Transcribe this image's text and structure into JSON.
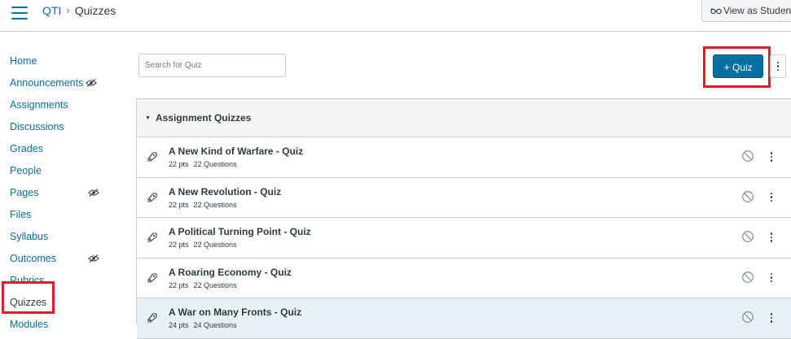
{
  "header": {
    "crumbs": [
      "QTI",
      "Quizzes"
    ],
    "crumb_separator": "›",
    "view_as_student": "View as Student",
    "view_icon": "glasses-icon"
  },
  "sidebar": {
    "items": [
      {
        "label": "Home",
        "hidden": false
      },
      {
        "label": "Announcements",
        "hidden": true
      },
      {
        "label": "Assignments",
        "hidden": false
      },
      {
        "label": "Discussions",
        "hidden": false
      },
      {
        "label": "Grades",
        "hidden": false
      },
      {
        "label": "People",
        "hidden": false
      },
      {
        "label": "Pages",
        "hidden": true
      },
      {
        "label": "Files",
        "hidden": false
      },
      {
        "label": "Syllabus",
        "hidden": false
      },
      {
        "label": "Outcomes",
        "hidden": true
      },
      {
        "label": "Rubrics",
        "hidden": false
      },
      {
        "label": "Quizzes",
        "hidden": false,
        "active": true
      },
      {
        "label": "Modules",
        "hidden": false
      }
    ]
  },
  "search": {
    "placeholder": "Search for Quiz"
  },
  "add_button": {
    "plus": "+",
    "label": "Quiz"
  },
  "group": {
    "title": "Assignment Quizzes",
    "quizzes": [
      {
        "title": "A New Kind of Warfare - Quiz",
        "points": "22 pts",
        "questions": "22 Questions"
      },
      {
        "title": "A New Revolution - Quiz",
        "points": "22 pts",
        "questions": "22 Questions"
      },
      {
        "title": "A Political Turning Point - Quiz",
        "points": "22 pts",
        "questions": "22 Questions"
      },
      {
        "title": "A Roaring Economy - Quiz",
        "points": "22 pts",
        "questions": "22 Questions"
      },
      {
        "title": "A War on Many Fronts - Quiz",
        "points": "24 pts",
        "questions": "24 Questions"
      }
    ]
  },
  "colors": {
    "link": "#0770a3",
    "highlight": "#e3192c",
    "button": "#0770a3"
  }
}
